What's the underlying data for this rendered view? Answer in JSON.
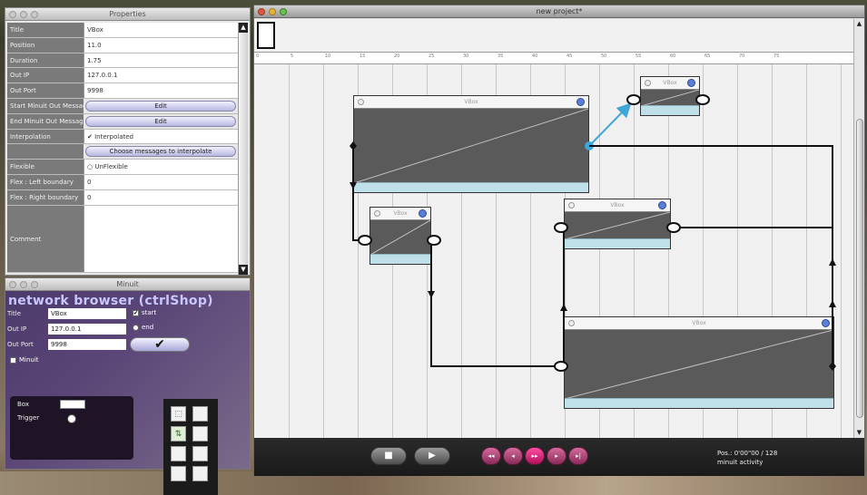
{
  "properties_window": {
    "title": "Properties",
    "rows": [
      {
        "label": "Title",
        "value": "VBox"
      },
      {
        "label": "Position",
        "value": "11.0"
      },
      {
        "label": "Duration",
        "value": "1.75"
      },
      {
        "label": "Out IP",
        "value": "127.0.0.1"
      },
      {
        "label": "Out Port",
        "value": "9998"
      },
      {
        "label": "Start Minuit Out Message",
        "button": "Edit"
      },
      {
        "label": "End Minuit Out Message",
        "button": "Edit"
      },
      {
        "label": "Interpolation",
        "checkbox": "Interpolated",
        "checked": true
      },
      {
        "label": "",
        "button": "Choose messages to interpolate"
      },
      {
        "label": "Flexible",
        "checkbox": "UnFlexible",
        "checked": false
      },
      {
        "label": "Flex : Left boundary",
        "value": "0"
      },
      {
        "label": "Flex : Right boundary",
        "value": "0"
      },
      {
        "label": "Comment",
        "value": ""
      }
    ]
  },
  "minuit_window": {
    "title": "Minuit",
    "network_title": "network browser (ctrlShop)",
    "title_label": "Title",
    "title_value": "VBox",
    "ip_label": "Out IP",
    "ip_value": "127.0.0.1",
    "port_label": "Out Port",
    "port_value": "9998",
    "start_label": "start",
    "end_label": "end",
    "minuit_label": "Minuit",
    "ok_glyph": "✔",
    "box_label": "Box",
    "trigger_label": "Trigger"
  },
  "main_window": {
    "title": "new project*",
    "ruler_ticks": [
      "0",
      "5",
      "10",
      "15",
      "20",
      "25",
      "30",
      "35",
      "40",
      "45",
      "50",
      "55",
      "60",
      "65",
      "70",
      "75"
    ],
    "boxes": [
      {
        "title": "VBox"
      },
      {
        "title": "VBox"
      },
      {
        "title": "VBox"
      },
      {
        "title": "VBox"
      },
      {
        "title": "VBox"
      }
    ],
    "transport": {
      "stop_glyph": "■",
      "play_glyph": "▶",
      "speed_glyphs": [
        "◂◂",
        "◂",
        "▸▸",
        "▸",
        "▸|"
      ],
      "position_text": "Pos.: 0'00\"00 / 128",
      "status_text": "minuit activity"
    }
  }
}
